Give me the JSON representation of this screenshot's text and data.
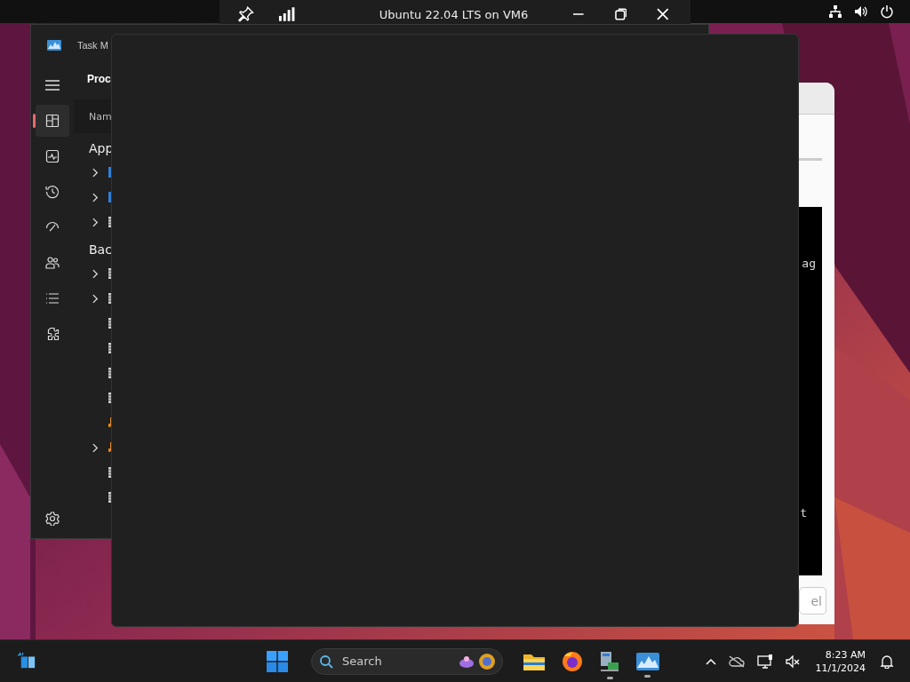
{
  "vm_bar": {
    "title": "Ubuntu 22.04 LTS on VM6"
  },
  "task_manager": {
    "title": "Task M",
    "page_title": "Proc",
    "column_1": "Nam",
    "nav_items": [
      {
        "kind": "processes",
        "selected": true
      },
      {
        "kind": "performance",
        "selected": false
      },
      {
        "kind": "history",
        "selected": false
      },
      {
        "kind": "startup",
        "selected": false
      },
      {
        "kind": "users",
        "selected": false
      },
      {
        "kind": "details",
        "selected": false
      },
      {
        "kind": "services",
        "selected": false
      }
    ],
    "groups": [
      {
        "title": "App",
        "rows": [
          {
            "kind": "app",
            "expandable": true
          },
          {
            "kind": "app",
            "expandable": true
          },
          {
            "kind": "system",
            "expandable": true
          }
        ]
      },
      {
        "title": "Bac",
        "rows": [
          {
            "kind": "system",
            "expandable": true
          },
          {
            "kind": "system",
            "expandable": true
          },
          {
            "kind": "system",
            "expandable": false
          },
          {
            "kind": "system",
            "expandable": false
          },
          {
            "kind": "system",
            "expandable": false
          },
          {
            "kind": "system",
            "expandable": false
          },
          {
            "kind": "audio",
            "expandable": false
          },
          {
            "kind": "audio",
            "expandable": true
          },
          {
            "kind": "system",
            "expandable": false
          },
          {
            "kind": "system",
            "expandable": false
          }
        ]
      }
    ]
  },
  "dialog": {
    "terminal_lines": [
      "ag",
      "t"
    ],
    "button": "el"
  },
  "taskbar": {
    "search": {
      "placeholder": "Search"
    },
    "time": "8:23 AM",
    "date": "11/1/2024"
  }
}
